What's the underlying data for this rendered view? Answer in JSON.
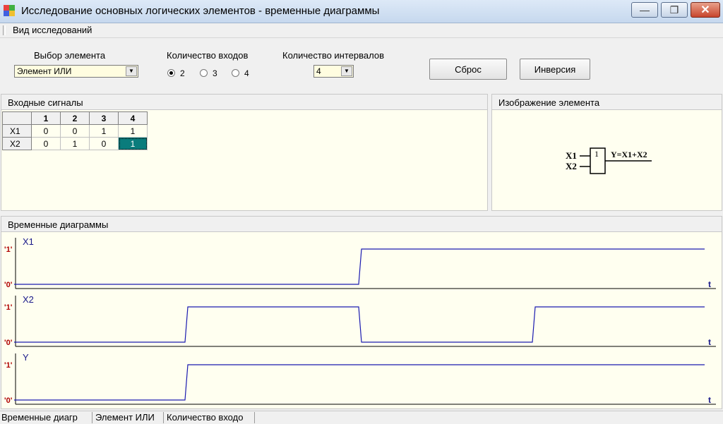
{
  "window": {
    "title": "Исследование основных логических элементов - временные диаграммы",
    "min_glyph": "—",
    "max_glyph": "❐",
    "close_glyph": "✕"
  },
  "menu": {
    "items": [
      {
        "label": "Вид исследований"
      }
    ]
  },
  "controls": {
    "element_label": "Выбор элемента",
    "element_value": "Элемент ИЛИ",
    "inputs_label": "Количество входов",
    "inputs_options": [
      "2",
      "3",
      "4"
    ],
    "inputs_selected": "2",
    "intervals_label": "Количество интервалов",
    "intervals_value": "4",
    "reset_label": "Сброс",
    "inversion_label": "Инверсия"
  },
  "input_signals": {
    "title": "Входные сигналы",
    "columns": [
      "1",
      "2",
      "3",
      "4"
    ],
    "rows": [
      {
        "name": "X1",
        "values": [
          "0",
          "0",
          "1",
          "1"
        ]
      },
      {
        "name": "X2",
        "values": [
          "0",
          "1",
          "0",
          "1"
        ]
      }
    ],
    "selected_cell": {
      "row": 1,
      "col": 3
    }
  },
  "element_image": {
    "title": "Изображение элемента",
    "input1": "X1",
    "input2": "X2",
    "symbol": "1",
    "output": "Y=X1+X2"
  },
  "timing": {
    "title": "Временные диаграммы",
    "level_high": "'1'",
    "level_low": "'0'",
    "time_label": "t",
    "line_color": "#1a1ab0",
    "signals": [
      {
        "name": "X1",
        "values": [
          0,
          0,
          1,
          1
        ]
      },
      {
        "name": "X2",
        "values": [
          0,
          1,
          0,
          1
        ]
      },
      {
        "name": "Y",
        "values": [
          0,
          1,
          1,
          1
        ]
      }
    ]
  },
  "statusbar": {
    "panels": [
      "Временные диагр",
      "Элемент ИЛИ",
      "Количество входо"
    ]
  }
}
